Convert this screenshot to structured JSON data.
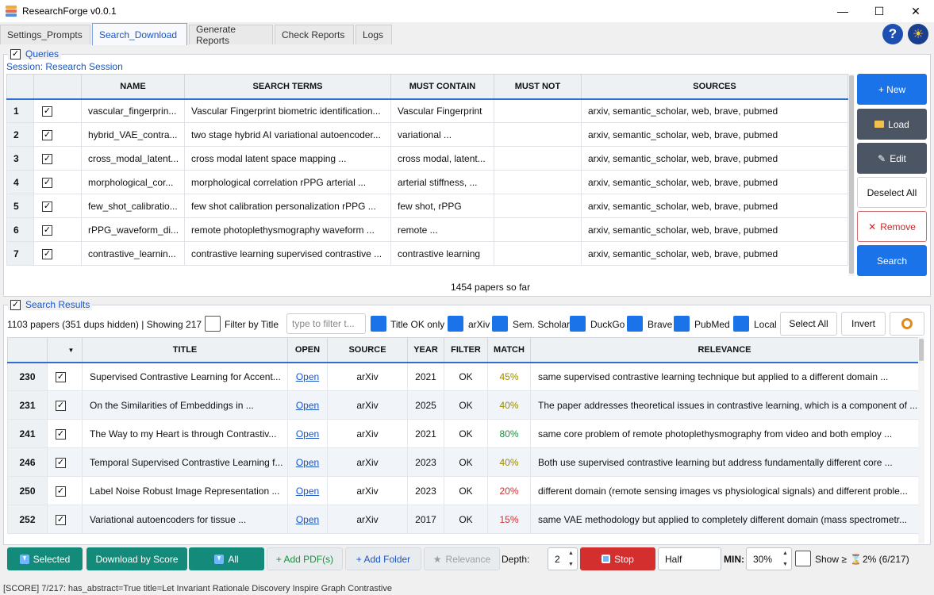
{
  "window": {
    "title": "ResearchForge v0.0.1",
    "minimize": "—",
    "maximize": "☐",
    "close": "✕"
  },
  "tabs": [
    {
      "label": "Settings_Prompts"
    },
    {
      "label": "Search_Download"
    },
    {
      "label": "Generate Reports"
    },
    {
      "label": "Check Reports"
    },
    {
      "label": "Logs"
    }
  ],
  "icons": {
    "help": "?",
    "theme": "☀"
  },
  "queries": {
    "group_title": "Queries",
    "session": "Session: Research Session",
    "columns": [
      "NAME",
      "SEARCH TERMS",
      "MUST CONTAIN",
      "MUST NOT",
      "SOURCES"
    ],
    "rows": [
      {
        "num": "1",
        "name": "vascular_fingerprin...",
        "terms": "Vascular Fingerprint biometric identification...",
        "must": "Vascular Fingerprint",
        "not": "",
        "sources": "arxiv, semantic_scholar, web, brave, pubmed"
      },
      {
        "num": "2",
        "name": "hybrid_VAE_contra...",
        "terms": "two stage hybrid AI variational autoencoder...",
        "must": "variational ...",
        "not": "",
        "sources": "arxiv, semantic_scholar, web, brave, pubmed"
      },
      {
        "num": "3",
        "name": "cross_modal_latent...",
        "terms": "cross modal latent space mapping ...",
        "must": "cross modal, latent...",
        "not": "",
        "sources": "arxiv, semantic_scholar, web, brave, pubmed"
      },
      {
        "num": "4",
        "name": "morphological_cor...",
        "terms": "morphological correlation rPPG arterial ...",
        "must": "arterial stiffness, ...",
        "not": "",
        "sources": "arxiv, semantic_scholar, web, brave, pubmed"
      },
      {
        "num": "5",
        "name": "few_shot_calibratio...",
        "terms": "few shot calibration personalization rPPG ...",
        "must": "few shot, rPPG",
        "not": "",
        "sources": "arxiv, semantic_scholar, web, brave, pubmed"
      },
      {
        "num": "6",
        "name": "rPPG_waveform_di...",
        "terms": "remote photoplethysmography waveform ...",
        "must": "remote ...",
        "not": "",
        "sources": "arxiv, semantic_scholar, web, brave, pubmed"
      },
      {
        "num": "7",
        "name": "contrastive_learnin...",
        "terms": "contrastive learning supervised contrastive ...",
        "must": "contrastive learning",
        "not": "",
        "sources": "arxiv, semantic_scholar, web, brave, pubmed"
      }
    ],
    "papers_so_far": "1454 papers so far",
    "buttons": {
      "new": "+ New",
      "load": "Load",
      "edit": "Edit",
      "deselect_all": "Deselect All",
      "remove": "Remove",
      "search": "Search"
    }
  },
  "results": {
    "group_title": "Search Results",
    "summary": "1103 papers (351 dups hidden) | Showing 217",
    "filter_by_title": "Filter by Title",
    "filter_placeholder": "type to filter t...",
    "toggles": {
      "title_ok": "Title OK only",
      "arxiv": "arXiv",
      "sem_scholar": "Sem. Scholar",
      "duckgo": "DuckGo",
      "brave": "Brave",
      "pubmed": "PubMed",
      "local": "Local"
    },
    "select_all": "Select All",
    "invert": "Invert",
    "columns": [
      "TITLE",
      "OPEN",
      "SOURCE",
      "YEAR",
      "FILTER",
      "MATCH",
      "RELEVANCE"
    ],
    "rows": [
      {
        "num": "230",
        "title": "Supervised Contrastive Learning for Accent...",
        "open": "Open",
        "source": "arXiv",
        "year": "2021",
        "filter": "OK",
        "match": "45%",
        "match_color": "#9a8a00",
        "relevance": "same supervised contrastive learning technique but applied to a different domain ..."
      },
      {
        "num": "231",
        "title": "On the Similarities of Embeddings in ...",
        "open": "Open",
        "source": "arXiv",
        "year": "2025",
        "filter": "OK",
        "match": "40%",
        "match_color": "#9a8a00",
        "relevance": "The paper addresses theoretical issues in contrastive learning, which is a component of ..."
      },
      {
        "num": "241",
        "title": "The Way to my Heart is through Contrastiv...",
        "open": "Open",
        "source": "arXiv",
        "year": "2021",
        "filter": "OK",
        "match": "80%",
        "match_color": "#1e8e3e",
        "relevance": "same core problem of remote photoplethysmography from video and both employ ..."
      },
      {
        "num": "246",
        "title": "Temporal Supervised Contrastive Learning f...",
        "open": "Open",
        "source": "arXiv",
        "year": "2023",
        "filter": "OK",
        "match": "40%",
        "match_color": "#9a8a00",
        "relevance": "Both use supervised contrastive learning but address fundamentally different core ..."
      },
      {
        "num": "250",
        "title": "Label Noise Robust Image Representation ...",
        "open": "Open",
        "source": "arXiv",
        "year": "2023",
        "filter": "OK",
        "match": "20%",
        "match_color": "#d32f2f",
        "relevance": "different domain (remote sensing images vs physiological signals) and different proble..."
      },
      {
        "num": "252",
        "title": "Variational autoencoders for tissue ...",
        "open": "Open",
        "source": "arXiv",
        "year": "2017",
        "filter": "OK",
        "match": "15%",
        "match_color": "#d32f2f",
        "relevance": "same VAE methodology but applied to completely different domain (mass spectrometr..."
      }
    ]
  },
  "bottom": {
    "selected": "Selected",
    "download_by_score": "Download by Score",
    "all": "All",
    "add_pdfs": "+ Add PDF(s)",
    "add_folder": "+ Add Folder",
    "relevance": "Relevance",
    "depth_label": "Depth:",
    "depth_value": "2",
    "stop": "Stop",
    "mode_value": "Half",
    "min_label": "MIN:",
    "min_value": "30%",
    "show_label": "Show ≥",
    "progress": "2% (6/217)"
  },
  "status": "[SCORE] 7/217: has_abstract=True title=Let Invariant Rationale Discovery Inspire Graph Contrastive"
}
